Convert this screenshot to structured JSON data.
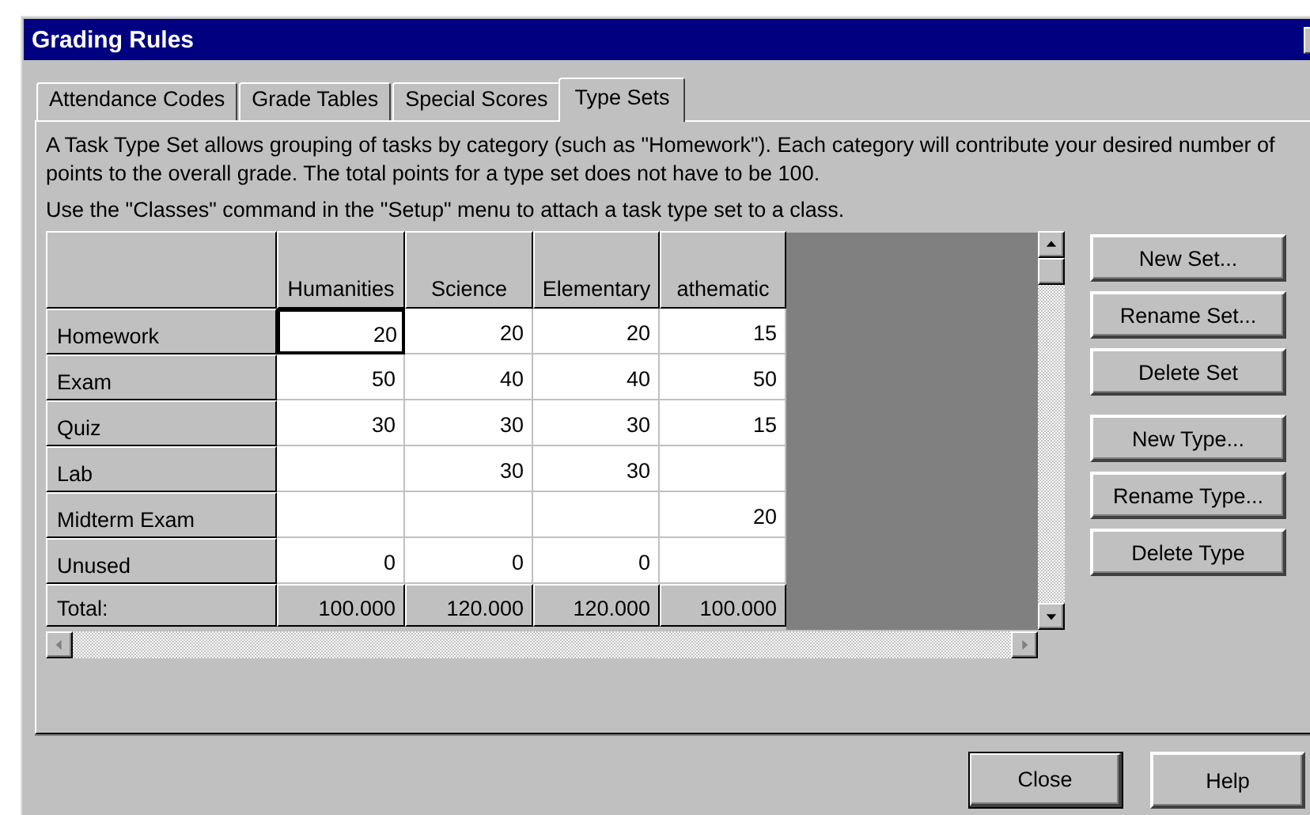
{
  "window": {
    "title": "Grading Rules"
  },
  "tabs": [
    {
      "label": "Attendance Codes",
      "selected": false
    },
    {
      "label": "Grade Tables",
      "selected": false
    },
    {
      "label": "Special Scores",
      "selected": false
    },
    {
      "label": "Type Sets",
      "selected": true
    }
  ],
  "description": [
    "A Task Type Set allows grouping of tasks by category (such as \"Homework\"). Each category will contribute your desired number of points to the overall grade. The total points for a type set does not have to be 100.",
    "Use the \"Classes\" command in the \"Setup\" menu to attach a task type set to a class."
  ],
  "table": {
    "columns": [
      "Humanities",
      "Science",
      "Elementary",
      "athematic"
    ],
    "rows": [
      {
        "label": "Homework",
        "cells": [
          {
            "value": "20",
            "selected": true
          },
          {
            "value": "20",
            "selected": false
          },
          {
            "value": "20",
            "selected": false
          },
          {
            "value": "15",
            "selected": false
          }
        ]
      },
      {
        "label": "Exam",
        "cells": [
          {
            "value": "50",
            "selected": false
          },
          {
            "value": "40",
            "selected": false
          },
          {
            "value": "40",
            "selected": false
          },
          {
            "value": "50",
            "selected": false
          }
        ]
      },
      {
        "label": "Quiz",
        "cells": [
          {
            "value": "30",
            "selected": false
          },
          {
            "value": "30",
            "selected": false
          },
          {
            "value": "30",
            "selected": false
          },
          {
            "value": "15",
            "selected": false
          }
        ]
      },
      {
        "label": "Lab",
        "cells": [
          {
            "selected": false
          },
          {
            "value": "30",
            "selected": false
          },
          {
            "value": "30",
            "selected": false
          },
          {
            "selected": false
          }
        ]
      },
      {
        "label": "Midterm Exam",
        "cells": [
          {
            "selected": false
          },
          {
            "selected": false
          },
          {
            "selected": false
          },
          {
            "value": "20",
            "selected": false
          }
        ]
      },
      {
        "label": "Unused",
        "cells": [
          {
            "value": "0",
            "selected": false
          },
          {
            "value": "0",
            "selected": false
          },
          {
            "value": "0",
            "selected": false
          },
          {
            "selected": false
          }
        ]
      }
    ],
    "totals": {
      "label": "Total:",
      "cells": [
        "100.000",
        "120.000",
        "120.000",
        "100.000"
      ]
    }
  },
  "set_buttons": [
    "New Set...",
    "Rename Set...",
    "Delete Set"
  ],
  "type_buttons": [
    "New Type...",
    "Rename Type...",
    "Delete Type"
  ],
  "footer_buttons": [
    {
      "label": "Close",
      "default": true
    },
    {
      "label": "Help",
      "default": false
    }
  ]
}
